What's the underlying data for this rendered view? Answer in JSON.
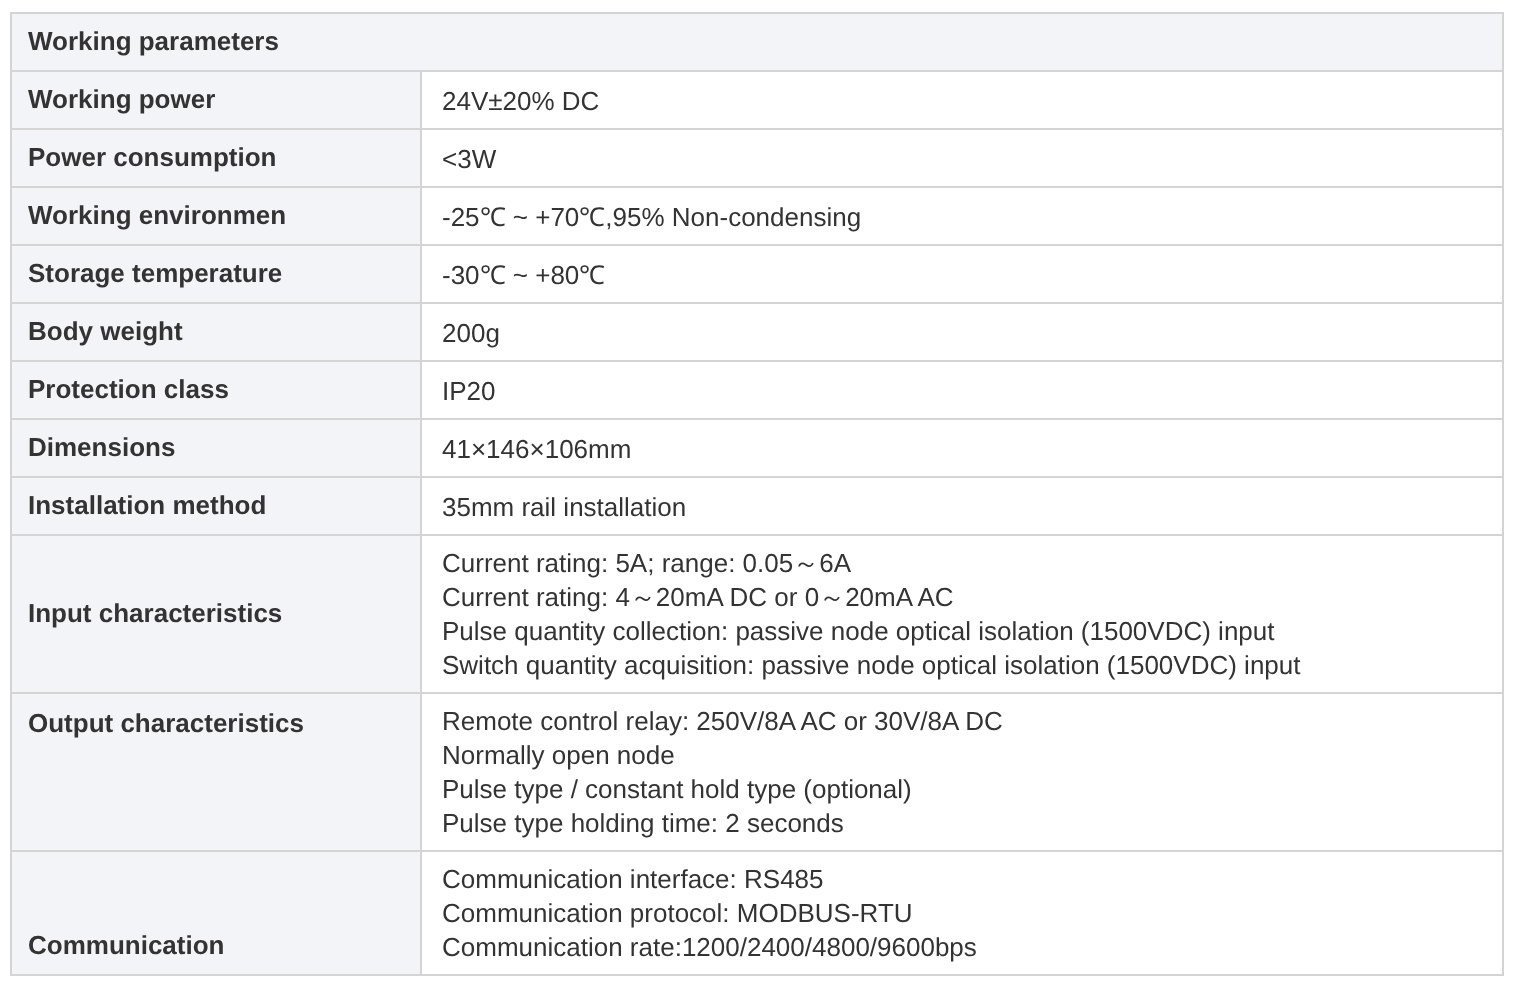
{
  "table": {
    "title": "Working parameters",
    "rows": [
      {
        "label": "Working power",
        "lines": [
          "24V±20% DC"
        ]
      },
      {
        "label": "Power consumption",
        "lines": [
          "<3W"
        ]
      },
      {
        "label": "Working environmen",
        "lines": [
          "-25℃ ~ +70℃,95% Non-condensing"
        ]
      },
      {
        "label": "Storage temperature",
        "lines": [
          "-30℃ ~ +80℃"
        ]
      },
      {
        "label": "Body weight",
        "lines": [
          "200g"
        ]
      },
      {
        "label": "Protection class",
        "lines": [
          "IP20"
        ]
      },
      {
        "label": "Dimensions",
        "lines": [
          "41×146×106mm"
        ]
      },
      {
        "label": "Installation method",
        "lines": [
          "35mm rail installation"
        ]
      },
      {
        "label": "Input characteristics",
        "label_at_top": false,
        "label_at_bottom": false,
        "lines": [
          "Current rating: 5A; range: 0.05～6A",
          "Current rating: 4～20mA DC or 0～20mA AC",
          "Pulse quantity collection: passive node optical isolation (1500VDC) input",
          "Switch quantity acquisition: passive node optical isolation (1500VDC) input"
        ]
      },
      {
        "label": "Output characteristics",
        "label_at_top": true,
        "label_at_bottom": false,
        "lines": [
          "Remote control relay: 250V/8A AC or 30V/8A DC",
          "Normally open node",
          "Pulse type / constant hold type (optional)",
          "Pulse type holding time: 2 seconds"
        ]
      },
      {
        "label": "Communication",
        "label_at_top": false,
        "label_at_bottom": true,
        "lines": [
          "Communication interface: RS485",
          "Communication protocol: MODBUS-RTU",
          "Communication rate:1200/2400/4800/9600bps"
        ]
      }
    ]
  }
}
